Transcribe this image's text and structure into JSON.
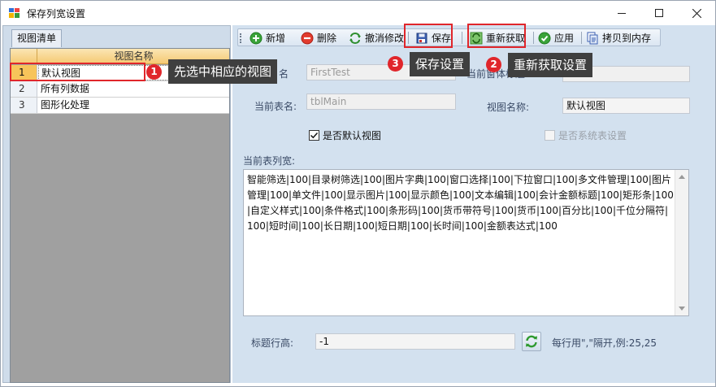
{
  "window": {
    "title": "保存列宽设置"
  },
  "left_panel": {
    "tab_label": "视图清单",
    "column_header": "视图名称",
    "rows": [
      {
        "num": "1",
        "name": "默认视图"
      },
      {
        "num": "2",
        "name": "所有列数据"
      },
      {
        "num": "3",
        "name": "图形化处理"
      }
    ]
  },
  "toolbar": {
    "new_label": "新增",
    "delete_label": "删除",
    "undo_label": "撤消修改",
    "save_label": "保存",
    "refetch_label": "重新获取",
    "apply_label": "应用",
    "copy_label": "拷贝到内存"
  },
  "form": {
    "form_name_label": "名",
    "form_name_value": "FirstTest",
    "form_title_label": "当前窗体标题",
    "table_name_label": "当前表名:",
    "table_name_value": "tblMain",
    "view_name_label": "视图名称:",
    "view_name_value": "默认视图",
    "default_view_label": "是否默认视图",
    "system_table_label": "是否系统表设置",
    "column_width_label": "当前表列宽:",
    "column_width_value": "智能筛选|100|目录树筛选|100|图片字典|100|窗口选择|100|下拉窗口|100|多文件管理|100|图片管理|100|单文件|100|显示图片|100|显示颜色|100|文本编辑|100|会计金额标题|100|矩形条|100|自定义样式|100|条件格式|100|条形码|100|货币带符号|100|货币|100|百分比|100|千位分隔符|100|短时间|100|长日期|100|短日期|100|长时间|100|金额表达式|100",
    "title_row_height_label": "标题行高:",
    "title_row_height_value": "-1",
    "title_row_hint": "每行用\",\"隔开,例:25,25"
  },
  "annotations": {
    "step1_number": "1",
    "step1_text": "先选中相应的视图",
    "step2_number": "2",
    "step2_text": "重新获取设置",
    "step3_number": "3",
    "step3_text": "保存设置"
  },
  "colors": {
    "highlight_red": "#e0262b",
    "selected_row": "#f7c45a",
    "panel_blue": "#d3e1ef",
    "callout_bg": "#3f3f3f"
  }
}
